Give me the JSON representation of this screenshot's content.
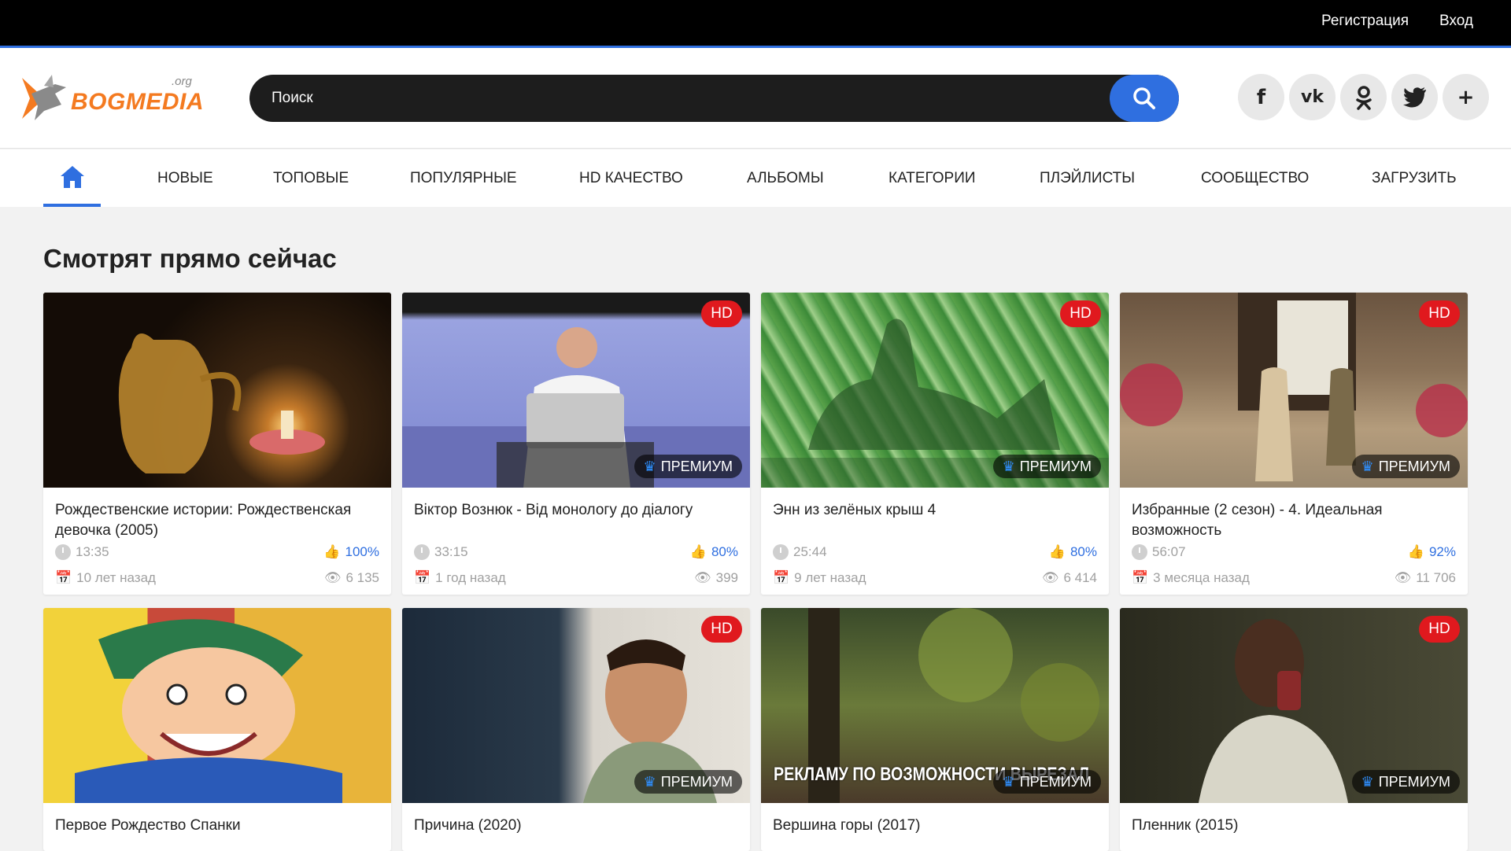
{
  "topbar": {
    "register": "Регистрация",
    "login": "Вход"
  },
  "logo": {
    "text": "BOGMEDIA",
    "suffix": ".org"
  },
  "search": {
    "placeholder": "Поиск"
  },
  "socials": [
    "facebook-icon",
    "vk-icon",
    "odnoklassniki-icon",
    "twitter-icon",
    "plus-icon"
  ],
  "nav": {
    "items": [
      "НОВЫЕ",
      "ТОПОВЫЕ",
      "ПОПУЛЯРНЫЕ",
      "HD КАЧЕСТВО",
      "АЛЬБОМЫ",
      "КАТЕГОРИИ",
      "ПЛЭЙЛИСТЫ",
      "СООБЩЕСТВО",
      "ЗАГРУЗИТЬ"
    ]
  },
  "section": {
    "title": "Смотрят прямо сейчас"
  },
  "badges": {
    "hd": "HD",
    "premium": "ПРЕМИУМ"
  },
  "colors": {
    "accent": "#2f6fe0",
    "hd": "#e0191e",
    "logo": "#f47a20"
  },
  "videos": [
    {
      "title": "Рождественские истории: Рождественская девочка (2005)",
      "duration": "13:35",
      "rating": "100%",
      "age": "10 лет назад",
      "views": "6 135",
      "hd": false,
      "premium": false
    },
    {
      "title": "Віктор Вознюк - Від монологу до діалогу",
      "duration": "33:15",
      "rating": "80%",
      "age": "1 год назад",
      "views": "399",
      "hd": true,
      "premium": true
    },
    {
      "title": "Энн из зелёных крыш 4",
      "duration": "25:44",
      "rating": "80%",
      "age": "9 лет назад",
      "views": "6 414",
      "hd": true,
      "premium": true
    },
    {
      "title": "Избранные (2 сезон) - 4. Идеальная возможность",
      "duration": "56:07",
      "rating": "92%",
      "age": "3 месяца назад",
      "views": "11 706",
      "hd": true,
      "premium": true
    },
    {
      "title": "Первое Рождество Спанки",
      "hd": false,
      "premium": false
    },
    {
      "title": "Причина (2020)",
      "hd": true,
      "premium": true
    },
    {
      "title": "Вершина горы (2017)",
      "hd": false,
      "premium": true,
      "overlay_text": "РЕКЛАМУ ПО ВОЗМОЖНОСТИ ВЫРЕЗАЛ"
    },
    {
      "title": "Пленник (2015)",
      "hd": true,
      "premium": true
    }
  ]
}
